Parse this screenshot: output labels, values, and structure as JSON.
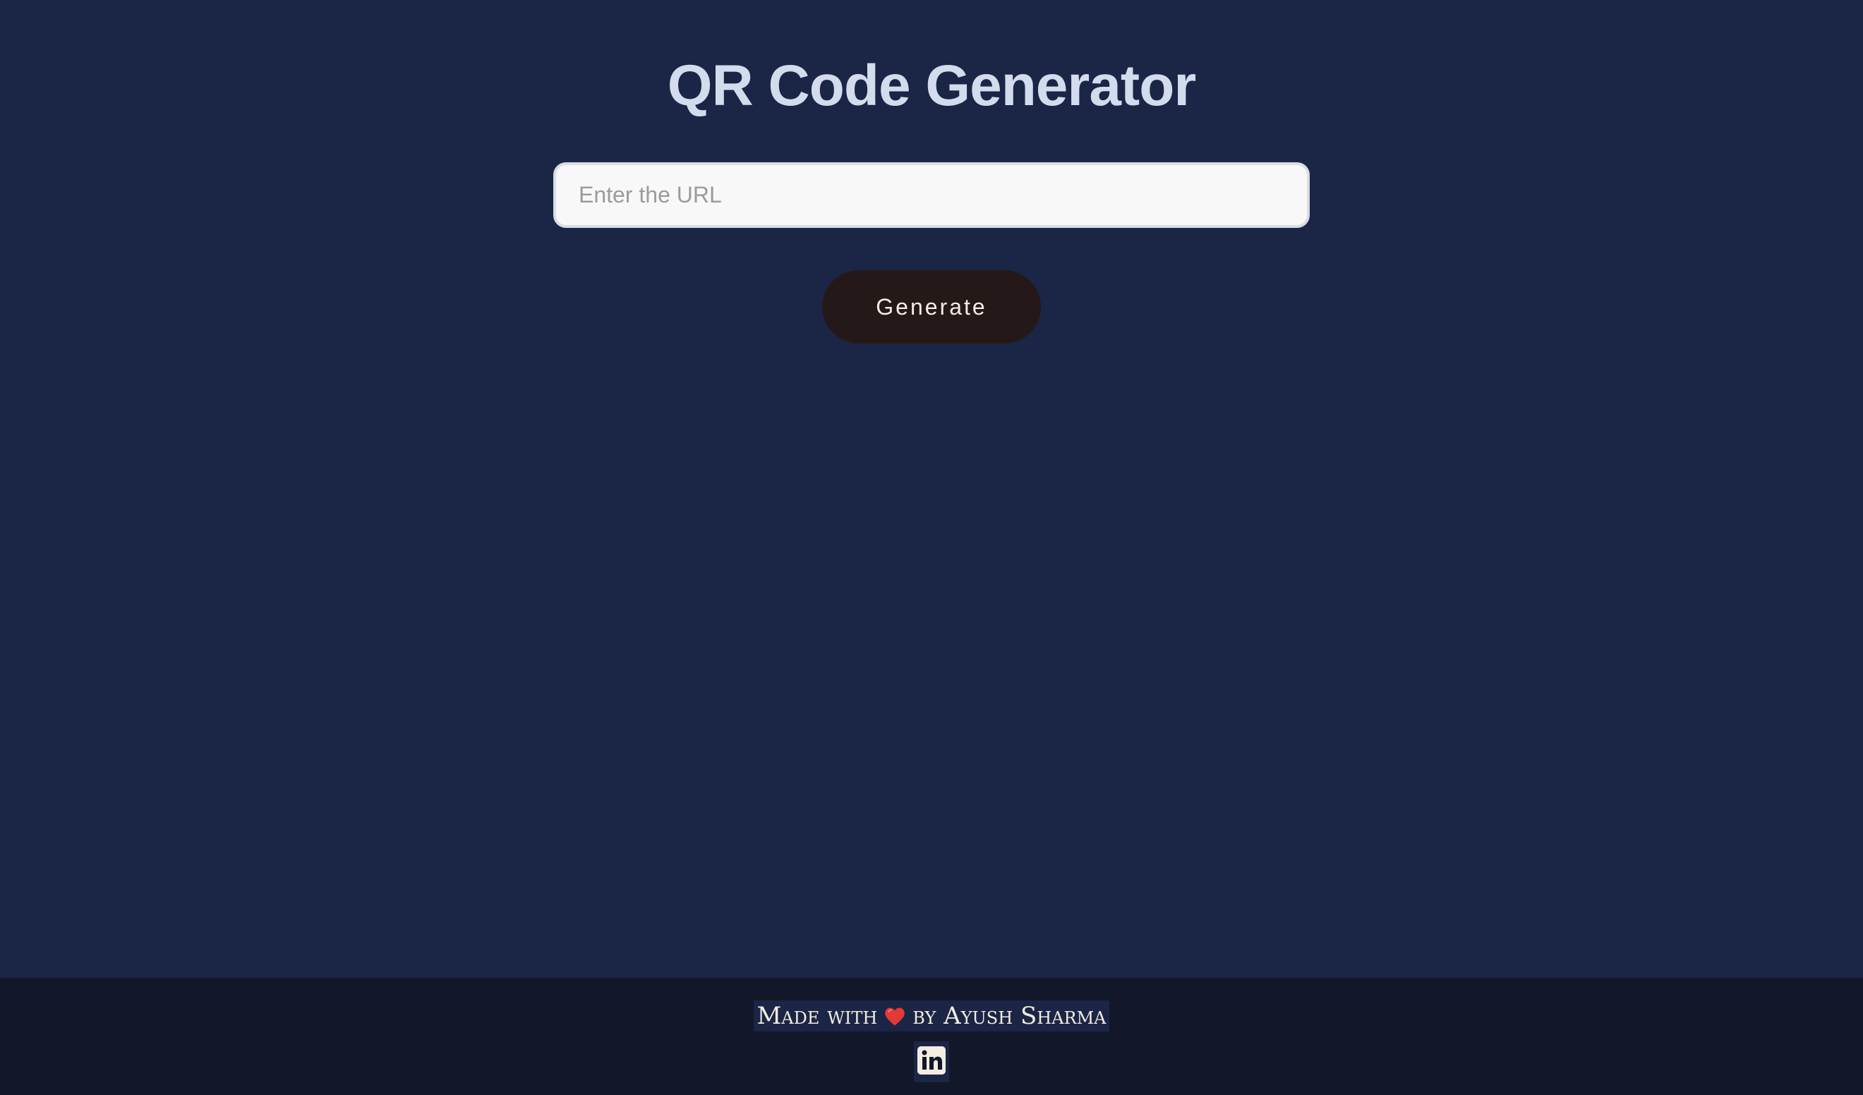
{
  "header": {
    "title": "QR Code Generator"
  },
  "form": {
    "url_placeholder": "Enter the URL",
    "url_value": "",
    "generate_label": "Generate"
  },
  "footer": {
    "credit_prefix": "Made with",
    "credit_suffix": "by Ayush Sharma",
    "heart_icon": "heart-icon",
    "social_icon": "linkedin-icon"
  },
  "colors": {
    "background": "#1b2545",
    "footer_background": "#12172a",
    "title": "#d3dcec",
    "button": "#241918",
    "heart": "#e53935"
  }
}
